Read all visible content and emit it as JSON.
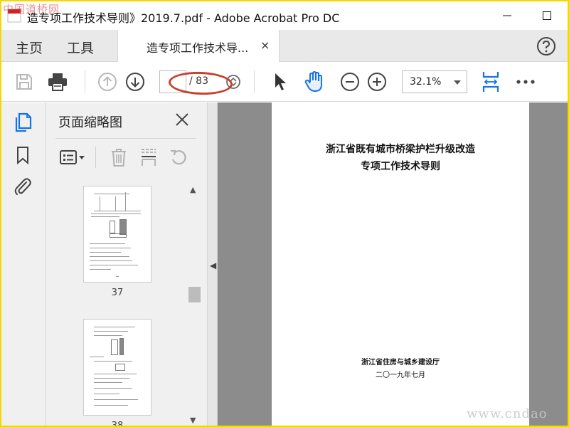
{
  "window": {
    "title": "造专项工作技术导则》2019.7.pdf - Adobe Acrobat Pro DC",
    "minimize": "—",
    "maximize": "☐"
  },
  "watermark_top": "中国道桥网",
  "watermark_bottom": "www.cndao",
  "tabs": {
    "home": "主页",
    "tools": "工具",
    "document": "造专项工作技术导...",
    "close": "×"
  },
  "toolbar": {
    "page_current": "",
    "page_total": "/ 83",
    "zoom": "32.1%"
  },
  "panel": {
    "title": "页面缩略图",
    "thumbnails": [
      {
        "page": "37"
      },
      {
        "page": "38"
      }
    ]
  },
  "document": {
    "title_line1": "浙江省既有城市桥梁护栏升级改造",
    "title_line2": "专项工作技术导则",
    "publisher": "浙江省住房与城乡建设厅",
    "date": "二〇一九年七月"
  },
  "colors": {
    "accent": "#1473e6",
    "annotation": "#c8402d",
    "frame": "#f2d800"
  }
}
